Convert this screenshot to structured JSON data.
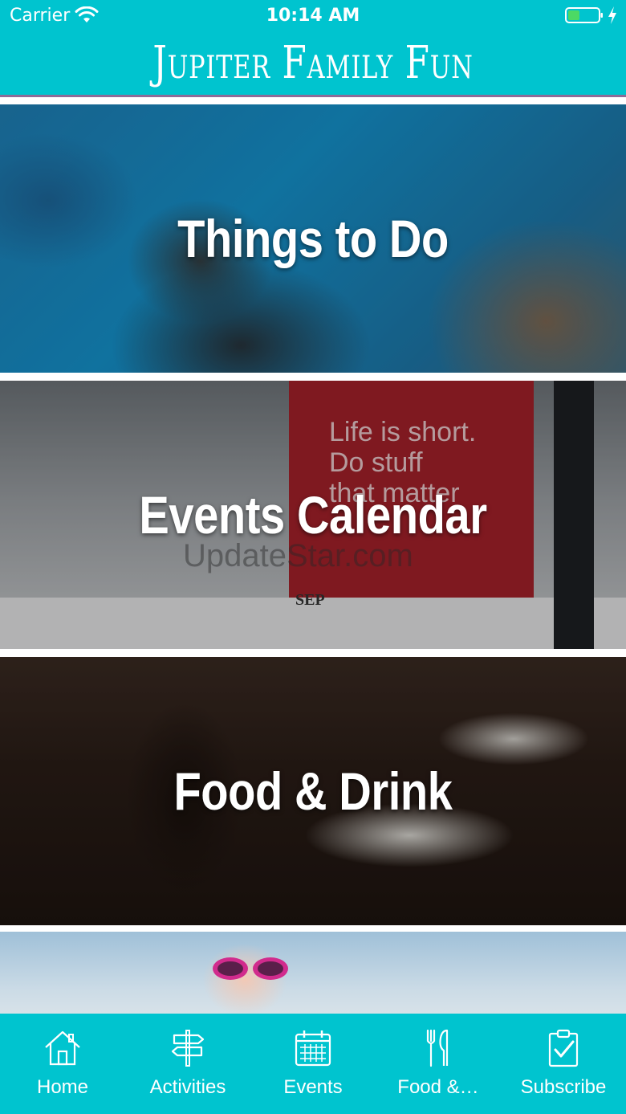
{
  "status_bar": {
    "carrier": "Carrier",
    "time": "10:14 AM",
    "wifi_icon": "wifi-icon",
    "battery_icon": "battery-icon",
    "charging_icon": "lightning-icon"
  },
  "header": {
    "title": "Jupiter Family Fun",
    "background_color": "#00c4cf"
  },
  "tiles": [
    {
      "label": "Things to Do",
      "image": "sea turtle swimming"
    },
    {
      "label": "Events Calendar",
      "image": "desk calendar",
      "photo_text": [
        "Life is short.",
        "Do stuff",
        "that matter"
      ],
      "photo_month": "SEP",
      "watermark": "UpdateStar.com"
    },
    {
      "label": "Food & Drink",
      "image": "glass of beer and cookie on plate"
    },
    {
      "label": "",
      "image": "child in pink sunglasses"
    }
  ],
  "tabbar": {
    "background_color": "#00c4cf",
    "tabs": [
      {
        "label": "Home",
        "icon": "home-icon"
      },
      {
        "label": "Activities",
        "icon": "signpost-icon"
      },
      {
        "label": "Events",
        "icon": "calendar-icon"
      },
      {
        "label": "Food &…",
        "icon": "fork-knife-icon"
      },
      {
        "label": "Subscribe",
        "icon": "clipboard-check-icon"
      }
    ]
  }
}
